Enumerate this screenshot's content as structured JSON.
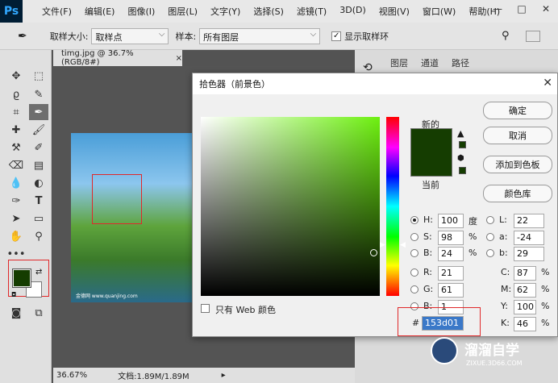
{
  "menubar": {
    "logo": "Ps",
    "items": [
      "文件(F)",
      "编辑(E)",
      "图像(I)",
      "图层(L)",
      "文字(Y)",
      "选择(S)",
      "滤镜(T)",
      "3D(D)",
      "视图(V)",
      "窗口(W)",
      "帮助(H)"
    ],
    "minimize": "—",
    "maximize": "□",
    "close": "✕"
  },
  "options": {
    "sample_size_label": "取样大小:",
    "sample_size_value": "取样点",
    "sample_label": "样本:",
    "sample_value": "所有图层",
    "show_ring_label": "显示取样环"
  },
  "document": {
    "tab": "timg.jpg @ 36.7%(RGB/8#)",
    "tab_close": "×",
    "photo_caption": "金德网 www.quanjing.com",
    "zoom": "36.67%",
    "doc_info": "文档:1.89M/1.89M"
  },
  "panels": {
    "tabs": [
      "图层",
      "通道",
      "路径"
    ]
  },
  "dialog": {
    "title": "拾色器（前景色）",
    "new_label": "新的",
    "current_label": "当前",
    "new_color": "#153d01",
    "current_color": "#153d01",
    "buttons": {
      "ok": "确定",
      "cancel": "取消",
      "add_swatch": "添加到色板",
      "color_library": "颜色库"
    },
    "web_only_label": "只有 Web 颜色",
    "hsb": [
      {
        "label": "H:",
        "value": "100",
        "unit": "度"
      },
      {
        "label": "S:",
        "value": "98",
        "unit": "%"
      },
      {
        "label": "B:",
        "value": "24",
        "unit": "%"
      }
    ],
    "lab": [
      {
        "label": "L:",
        "value": "22"
      },
      {
        "label": "a:",
        "value": "-24"
      },
      {
        "label": "b:",
        "value": "29"
      }
    ],
    "rgb": [
      {
        "label": "R:",
        "value": "21"
      },
      {
        "label": "G:",
        "value": "61"
      },
      {
        "label": "B:",
        "value": "1"
      }
    ],
    "cmyk": [
      {
        "label": "C:",
        "value": "87",
        "unit": "%"
      },
      {
        "label": "M:",
        "value": "62",
        "unit": "%"
      },
      {
        "label": "Y:",
        "value": "100",
        "unit": "%"
      },
      {
        "label": "K:",
        "value": "46",
        "unit": "%"
      }
    ],
    "hex_label": "#",
    "hex_value": "153d01"
  },
  "toolbar": {
    "foreground_color": "#153d01",
    "background_color": "#ffffff"
  },
  "watermark": {
    "title": "溜溜自学",
    "url": "ZIXUE.3D66.COM"
  },
  "accent": "#e0282a"
}
